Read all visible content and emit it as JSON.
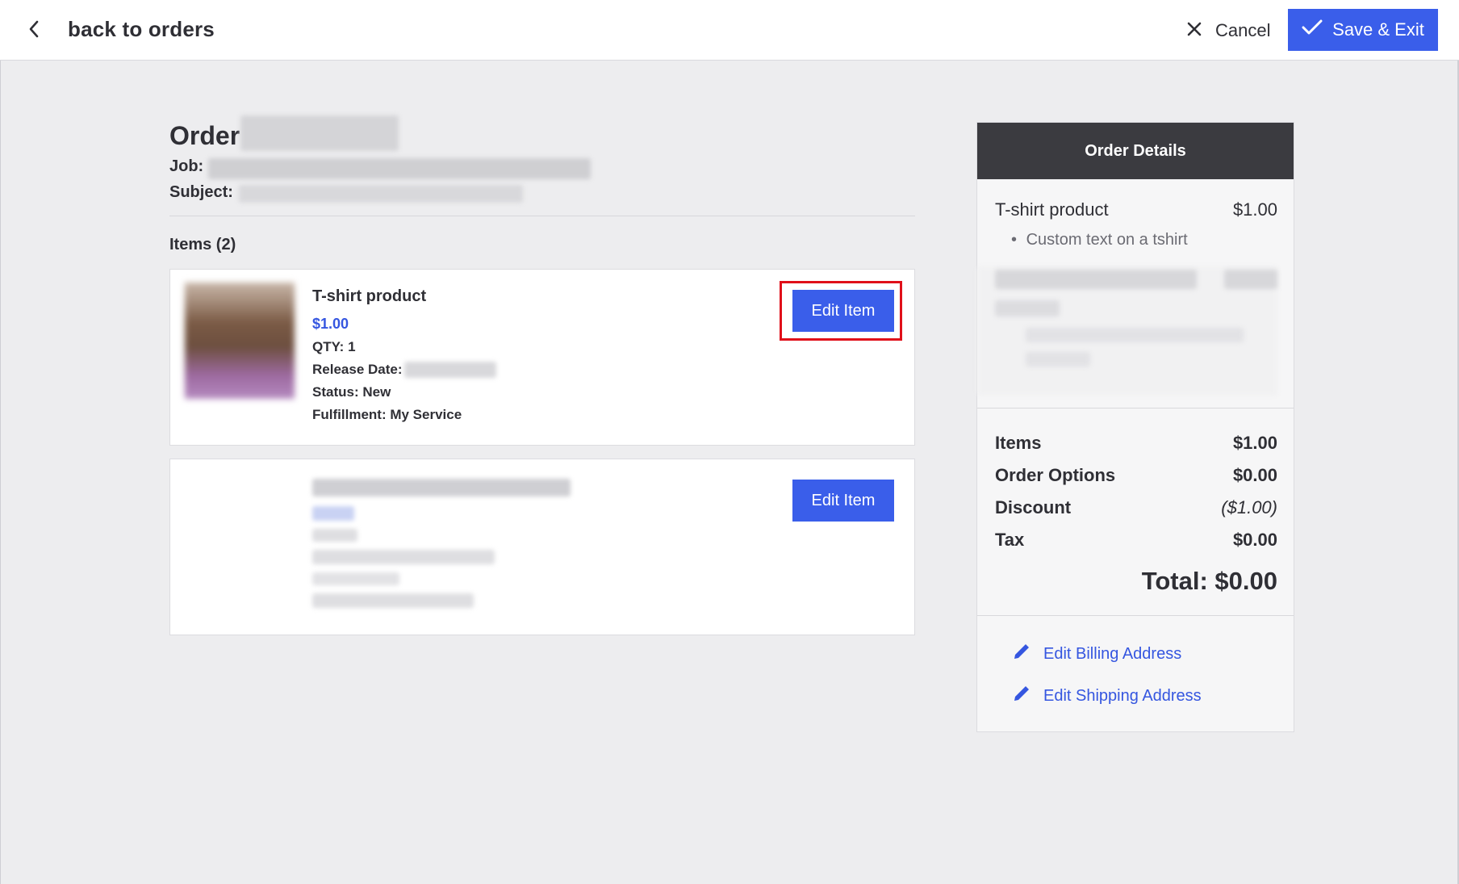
{
  "header": {
    "back_label": "back to orders",
    "cancel_label": "Cancel",
    "save_label": "Save & Exit"
  },
  "order": {
    "title": "Order",
    "job_label": "Job:",
    "subject_label": "Subject:"
  },
  "items_section": {
    "heading": "Items (2)",
    "items": [
      {
        "name": "T-shirt product",
        "price": "$1.00",
        "qty": "QTY: 1",
        "release_date_label": "Release Date:",
        "status": "Status: New",
        "fulfillment": "Fulfillment: My Service",
        "edit_label": "Edit Item"
      },
      {
        "edit_label": "Edit Item"
      }
    ]
  },
  "details": {
    "header": "Order Details",
    "line_items": [
      {
        "name": "T-shirt product",
        "price": "$1.00",
        "sub": "Custom text on a tshirt"
      }
    ],
    "summary": {
      "items_label": "Items",
      "items_value": "$1.00",
      "options_label": "Order Options",
      "options_value": "$0.00",
      "discount_label": "Discount",
      "discount_value": "($1.00)",
      "tax_label": "Tax",
      "tax_value": "$0.00",
      "total": "Total: $0.00"
    },
    "links": {
      "billing": "Edit Billing Address",
      "shipping": "Edit Shipping Address"
    }
  },
  "colors": {
    "accent": "#3a5eea",
    "highlight": "#e0101a",
    "panel_header": "#3b3b40"
  }
}
